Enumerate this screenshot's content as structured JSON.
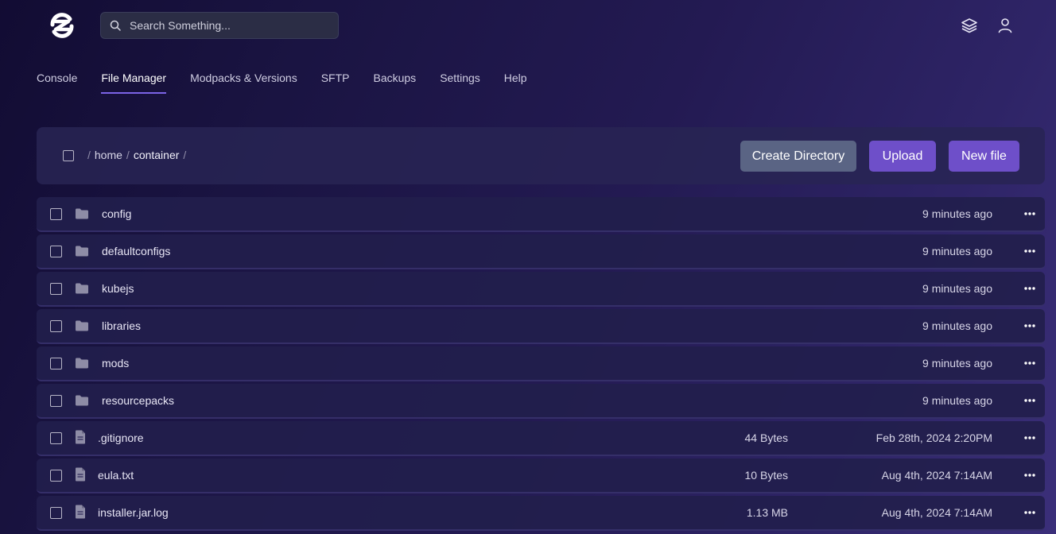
{
  "header": {
    "search_placeholder": "Search Something...",
    "icons": {
      "logo": "brand-s-logo",
      "search": "search-icon",
      "layers": "layers-icon",
      "user": "user-icon"
    }
  },
  "nav": {
    "tabs": [
      {
        "label": "Console",
        "active": false
      },
      {
        "label": "File Manager",
        "active": true
      },
      {
        "label": "Modpacks & Versions",
        "active": false
      },
      {
        "label": "SFTP",
        "active": false
      },
      {
        "label": "Backups",
        "active": false
      },
      {
        "label": "Settings",
        "active": false
      },
      {
        "label": "Help",
        "active": false
      }
    ]
  },
  "toolbar": {
    "breadcrumb": {
      "sep": "/",
      "items": [
        "home",
        "container"
      ]
    },
    "create_directory_label": "Create Directory",
    "upload_label": "Upload",
    "new_file_label": "New file"
  },
  "files": [
    {
      "name": "config",
      "type": "directory",
      "size": "",
      "modified": "9 minutes ago"
    },
    {
      "name": "defaultconfigs",
      "type": "directory",
      "size": "",
      "modified": "9 minutes ago"
    },
    {
      "name": "kubejs",
      "type": "directory",
      "size": "",
      "modified": "9 minutes ago"
    },
    {
      "name": "libraries",
      "type": "directory",
      "size": "",
      "modified": "9 minutes ago"
    },
    {
      "name": "mods",
      "type": "directory",
      "size": "",
      "modified": "9 minutes ago"
    },
    {
      "name": "resourcepacks",
      "type": "directory",
      "size": "",
      "modified": "9 minutes ago"
    },
    {
      "name": ".gitignore",
      "type": "file",
      "size": "44 Bytes",
      "modified": "Feb 28th, 2024 2:20PM"
    },
    {
      "name": "eula.txt",
      "type": "file",
      "size": "10 Bytes",
      "modified": "Aug 4th, 2024 7:14AM"
    },
    {
      "name": "installer.jar.log",
      "type": "file",
      "size": "1.13 MB",
      "modified": "Aug 4th, 2024 7:14AM"
    }
  ],
  "colors": {
    "accent": "#7b63e6",
    "button_primary": "#6e4fc9",
    "button_secondary": "#5a6484"
  }
}
